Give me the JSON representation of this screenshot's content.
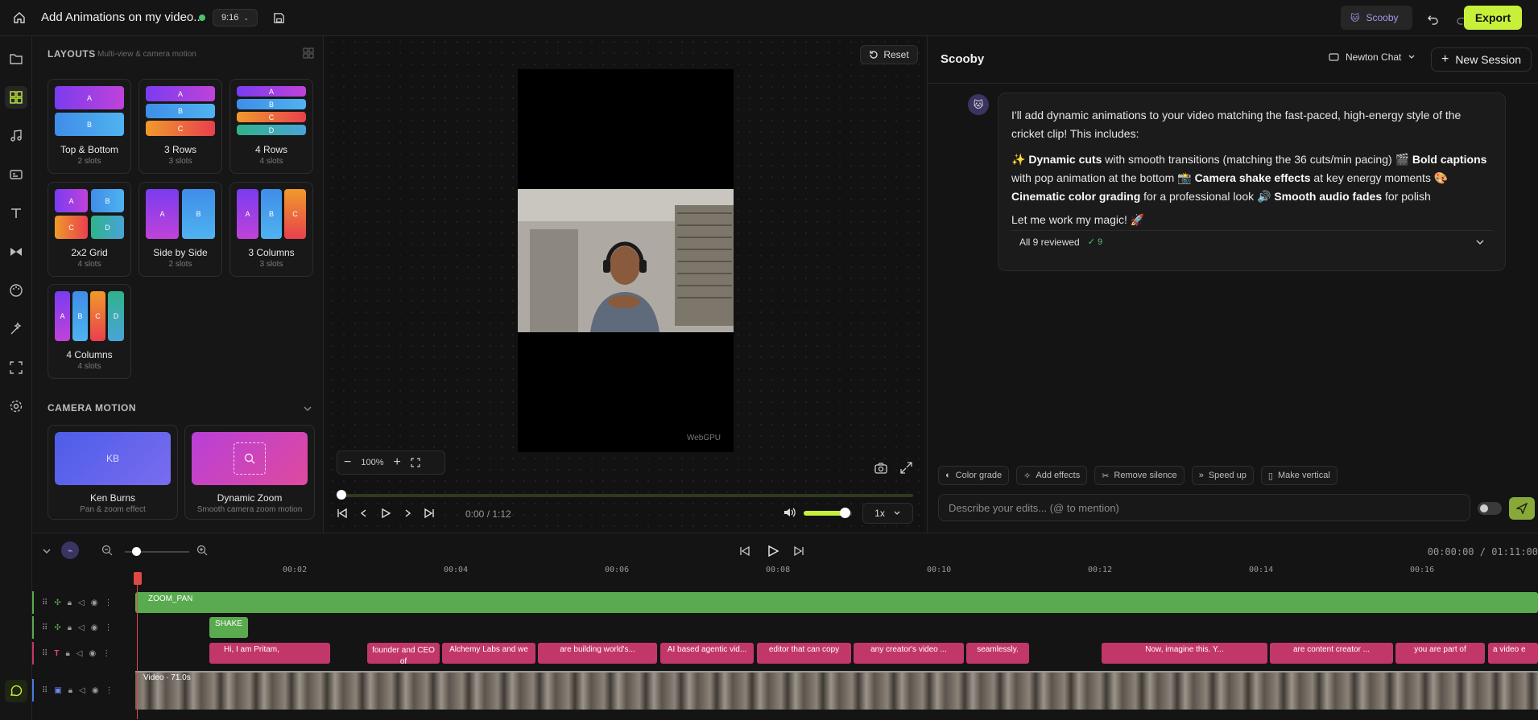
{
  "topbar": {
    "project_title": "Add Animations on my video...",
    "ratio": "9:16",
    "user_name": "Scooby",
    "export_label": "Export"
  },
  "rail": {
    "items": [
      "folder-icon",
      "layouts-icon",
      "music-icon",
      "captions-icon",
      "text-icon",
      "transitions-icon",
      "color-icon",
      "effects-icon",
      "crop-icon",
      "settings-icon",
      "chat-icon"
    ]
  },
  "layouts_panel": {
    "title": "LAYOUTS",
    "subtitle": "Multi-view & camera motion",
    "layouts": [
      {
        "name": "Top & Bottom",
        "slots": "2 slots",
        "labels": [
          "A",
          "B"
        ]
      },
      {
        "name": "3 Rows",
        "slots": "3 slots",
        "labels": [
          "A",
          "B",
          "C"
        ]
      },
      {
        "name": "4 Rows",
        "slots": "4 slots",
        "labels": [
          "A",
          "B",
          "C",
          "D"
        ]
      },
      {
        "name": "2x2 Grid",
        "slots": "4 slots",
        "labels": [
          "A",
          "B",
          "C",
          "D"
        ]
      },
      {
        "name": "Side by Side",
        "slots": "2 slots",
        "labels": [
          "A",
          "B"
        ]
      },
      {
        "name": "3 Columns",
        "slots": "3 slots",
        "labels": [
          "A",
          "B",
          "C"
        ]
      },
      {
        "name": "4 Columns",
        "slots": "4 slots",
        "labels": [
          "A",
          "B",
          "C",
          "D"
        ]
      }
    ],
    "camera_motion_title": "CAMERA MOTION",
    "camera_motions": [
      {
        "name": "Ken Burns",
        "desc": "Pan & zoom effect",
        "thumb_text": "KB"
      },
      {
        "name": "Dynamic Zoom",
        "desc": "Smooth camera zoom motion",
        "thumb_text": ""
      }
    ]
  },
  "preview": {
    "reset_label": "Reset",
    "zoom_level": "100%",
    "watermark": "WebGPU",
    "time": "0:00 / 1:12",
    "speed": "1x",
    "volume": 0.85,
    "progress": 0.0
  },
  "chat": {
    "title": "Scooby",
    "mode": "Newton Chat",
    "new_session_label": "New Session",
    "message": {
      "intro": "I'll add dynamic animations to your video matching the fast-paced, high-energy style of the cricket clip! This includes:",
      "items": [
        {
          "emoji": "✨",
          "bold": "Dynamic cuts",
          "text": " with smooth transitions (matching the 36 cuts/min pacing) "
        },
        {
          "emoji": "🎬",
          "bold": "Bold captions",
          "text": " with pop animation at the bottom "
        },
        {
          "emoji": "📸",
          "bold": "Camera shake effects",
          "text": " at key energy moments "
        },
        {
          "emoji": "🎨",
          "bold": "Cinematic color grading",
          "text": " for a professional look "
        },
        {
          "emoji": "🔊",
          "bold": "Smooth audio fades",
          "text": " for polish"
        }
      ],
      "outro": "Let me work my magic! 🚀"
    },
    "review_label": "All 9 reviewed",
    "review_count": "✓ 9",
    "chips": [
      "Color grade",
      "Add effects",
      "Remove silence",
      "Speed up",
      "Make vertical"
    ],
    "input_placeholder": "Describe your edits... (@ to mention)"
  },
  "timeline": {
    "time_readout": "00:00:00 / 01:11:00",
    "ticks": [
      "00:02",
      "00:04",
      "00:06",
      "00:08",
      "00:10",
      "00:12",
      "00:14",
      "00:16"
    ],
    "tracks": {
      "zoom_clip": "ZOOM_PAN",
      "shake_clip": "SHAKE",
      "caption_clips": [
        "Hi, I am Pritam,",
        "founder and CEO of",
        "Alchemy Labs and we",
        "are building world's...",
        "AI based agentic vid...",
        "editor that can copy",
        "any creator's video ...",
        "seamlessly.",
        "Now, imagine this. Y...",
        "are content creator ...",
        "you are part of",
        "a video e"
      ],
      "video_label": "Video · 71.0s"
    }
  }
}
